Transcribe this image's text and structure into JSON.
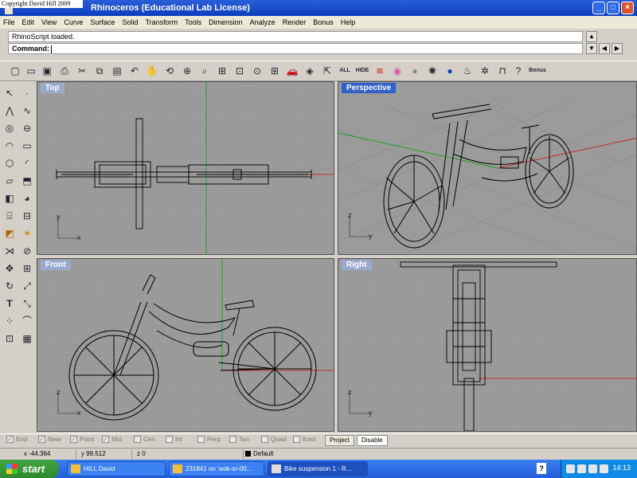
{
  "window": {
    "copyright": "Copyright David Hill 2009",
    "title": "Rhinoceros (Educational Lab License)",
    "controls": {
      "minimize": "_",
      "maximize": "□",
      "close": "×"
    }
  },
  "menu": [
    "File",
    "Edit",
    "View",
    "Curve",
    "Surface",
    "Solid",
    "Transform",
    "Tools",
    "Dimension",
    "Analyze",
    "Render",
    "Bonus",
    "Help"
  ],
  "command": {
    "history": "RhinoScript loaded.",
    "prompt": "Command:",
    "value": ""
  },
  "toolbar": {
    "icons": [
      "new-file-icon",
      "open-folder-icon",
      "save-icon",
      "print-icon",
      "cut-icon",
      "copy-icon",
      "paste-icon",
      "undo-icon",
      "pan-hand-icon",
      "rotate-view-icon",
      "zoom-window-icon",
      "zoom-dynamic-icon",
      "zoom-extents-icon",
      "zoom-selected-icon",
      "zoom-all-icon",
      "four-viewports-icon",
      "car-icon",
      "render-icon",
      "select-icon"
    ],
    "all_label": "ALL",
    "hide_label": "HIDE",
    "bonus_label": "Bonus"
  },
  "viewports": {
    "top": "Top",
    "perspective": "Perspective",
    "front": "Front",
    "right": "Right"
  },
  "axes": {
    "x": "x",
    "y": "y",
    "z": "z"
  },
  "osnap": {
    "items": [
      {
        "label": "End",
        "checked": true
      },
      {
        "label": "Near",
        "checked": true
      },
      {
        "label": "Point",
        "checked": true
      },
      {
        "label": "Mid",
        "checked": true
      },
      {
        "label": "Cen",
        "checked": false
      },
      {
        "label": "Int",
        "checked": false
      },
      {
        "label": "Perp",
        "checked": false
      },
      {
        "label": "Tan",
        "checked": false
      },
      {
        "label": "Quad",
        "checked": false
      },
      {
        "label": "Knot",
        "checked": false
      }
    ],
    "project": "Project",
    "disable": "Disable"
  },
  "status": {
    "x": "x -44.364",
    "y": "y 99.512",
    "z": "z 0",
    "layer": "Default"
  },
  "taskbar": {
    "start": "start",
    "tasks": [
      "HILL David",
      "23184‡ on 'wok-sr-00...",
      "Bike suspension 1 - R..."
    ],
    "help": "?",
    "clock": "14:13"
  },
  "colors": {
    "titlebar": "#0a3dbd",
    "viewport_bg": "#9b9b9b",
    "active_label": "#3060c8",
    "x_axis": "#c03030",
    "y_axis": "#20a020"
  }
}
